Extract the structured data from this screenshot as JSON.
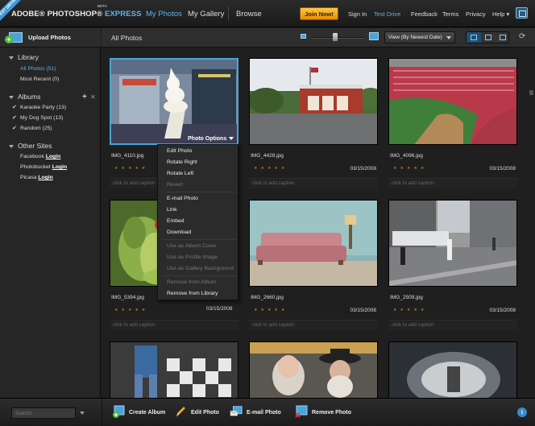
{
  "header": {
    "ribbon": "TEST DRIVE",
    "brand_main": "ADOBE® PHOTOSHOP®",
    "brand_express": "EXPRESS",
    "beta": "BETA",
    "tabs": [
      "My Photos",
      "My Gallery",
      "Browse"
    ],
    "join_label": "Join Now!",
    "links": [
      "Sign In",
      "Test Drive",
      "Feedback",
      "Terms",
      "Privacy",
      "Help ▾"
    ]
  },
  "sidebar": {
    "upload_label": "Upload Photos",
    "library_title": "Library",
    "library_items": [
      "All Photos (51)",
      "Most Recent (0)"
    ],
    "albums_title": "Albums",
    "album_items": [
      "Karaoke Party (13)",
      "My Dog Spot (13)",
      "Random (25)"
    ],
    "other_title": "Other Sites",
    "sites": [
      {
        "name": "Facebook",
        "action": "Login"
      },
      {
        "name": "Photobucket",
        "action": "Login"
      },
      {
        "name": "Picasa",
        "action": "Login"
      }
    ]
  },
  "main": {
    "title": "All Photos",
    "sort_label": "View (By Newest Date)"
  },
  "photos": [
    {
      "name": "IMG_4110.jpg",
      "date": "",
      "caption": "click to add caption",
      "rating": 5,
      "overlay": "Photo Options"
    },
    {
      "name": "IMG_4428.jpg",
      "date": "03/15/2008",
      "caption": "click to add caption",
      "rating": 5
    },
    {
      "name": "IMG_4096.jpg",
      "date": "03/15/2008",
      "caption": "click to add caption",
      "rating": 5
    },
    {
      "name": "IMG_5394.jpg",
      "date": "",
      "caption": "click to add caption",
      "rating": 5
    },
    {
      "name": "IMG_2660.jpg",
      "date": "03/15/2008",
      "caption": "click to add caption",
      "rating": 5
    },
    {
      "name": "IMG_2509.jpg",
      "date": "03/15/2008",
      "caption": "click to add caption",
      "rating": 5
    }
  ],
  "menu": {
    "items": [
      {
        "label": "Edit Photo",
        "enabled": true
      },
      {
        "label": "Rotate Right",
        "enabled": true
      },
      {
        "label": "Rotate Left",
        "enabled": true
      },
      {
        "label": "Revert",
        "enabled": false
      },
      {
        "label": "E-mail Photo",
        "enabled": true
      },
      {
        "label": "Link",
        "enabled": true
      },
      {
        "label": "Embed",
        "enabled": true
      },
      {
        "label": "Download",
        "enabled": true
      },
      {
        "label": "Use as Album Cover",
        "enabled": false
      },
      {
        "label": "Use as Profile Image",
        "enabled": false
      },
      {
        "label": "Use as Gallery Background",
        "enabled": false
      },
      {
        "label": "Remove from Album",
        "enabled": false
      },
      {
        "label": "Remove from Library",
        "enabled": true
      }
    ],
    "date_beside": "03/15/2008"
  },
  "bottom": {
    "search_placeholder": "Search",
    "actions": [
      "Create Album",
      "Edit Photo",
      "E-mail Photo",
      "Remove Photo"
    ]
  },
  "colors": {
    "accent": "#5fb3e8",
    "join": "#f5a000",
    "stars": "#b07b1c"
  }
}
